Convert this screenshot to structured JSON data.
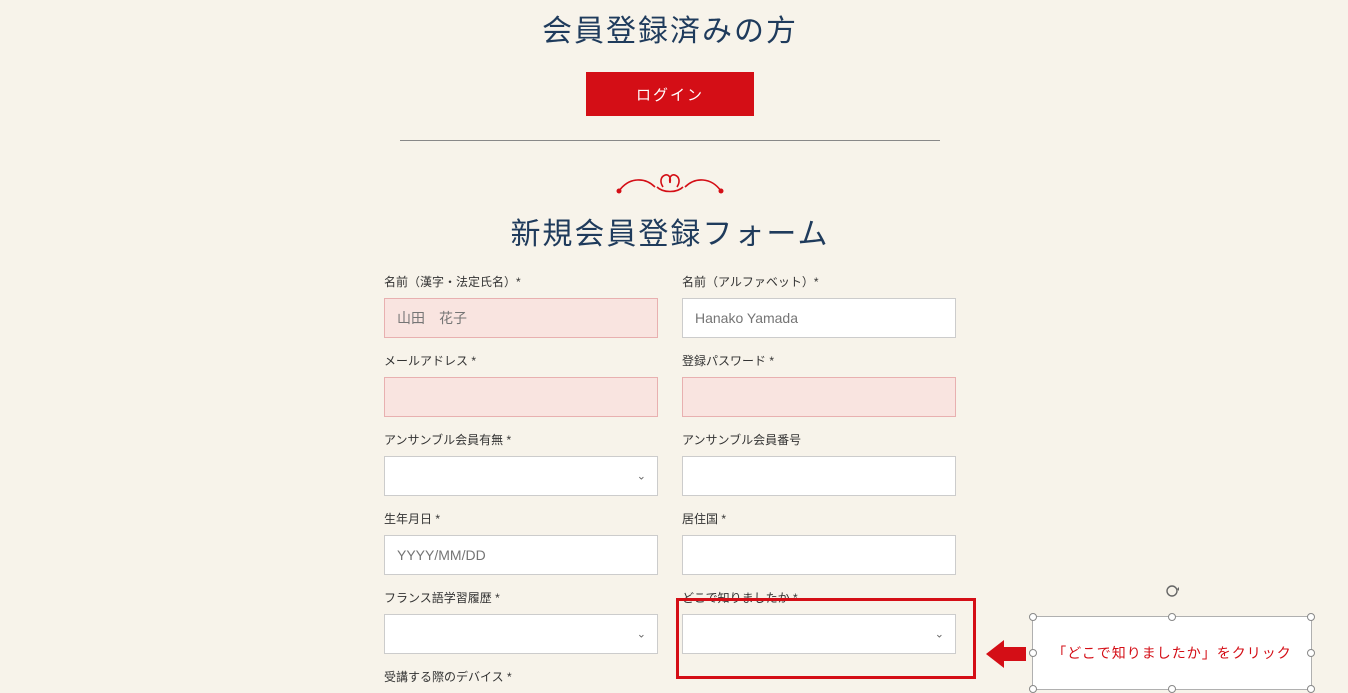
{
  "existing_member": {
    "title": "会員登録済みの方",
    "login_label": "ログイン"
  },
  "registration": {
    "title": "新規会員登録フォーム",
    "fields": {
      "name_kanji": {
        "label": "名前（漢字・法定氏名）*",
        "placeholder": "山田　花子",
        "value": ""
      },
      "name_alpha": {
        "label": "名前（アルファベット）*",
        "placeholder": "Hanako Yamada",
        "value": ""
      },
      "email": {
        "label": "メールアドレス *",
        "value": ""
      },
      "password": {
        "label": "登録パスワード *",
        "value": ""
      },
      "ensemble_member": {
        "label": "アンサンブル会員有無 *",
        "selected": ""
      },
      "ensemble_number": {
        "label": "アンサンブル会員番号",
        "value": ""
      },
      "birthdate": {
        "label": "生年月日 *",
        "placeholder": "YYYY/MM/DD",
        "value": ""
      },
      "country": {
        "label": "居住国 *",
        "value": ""
      },
      "french_history": {
        "label": "フランス語学習履歴 *",
        "selected": ""
      },
      "how_found": {
        "label": "どこで知りましたか *",
        "selected": ""
      },
      "device": {
        "label": "受講する際のデバイス *",
        "selected": ""
      }
    }
  },
  "annotation": {
    "callout_text": "「どこで知りましたか」をクリック"
  }
}
